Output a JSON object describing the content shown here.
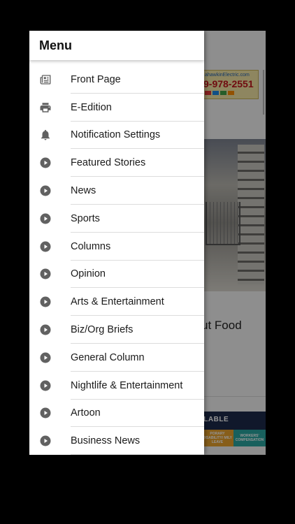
{
  "drawer": {
    "title": "Menu",
    "items": [
      {
        "label": "Front Page",
        "icon": "newspaper-icon"
      },
      {
        "label": "E-Edition",
        "icon": "printer-icon"
      },
      {
        "label": "Notification Settings",
        "icon": "bell-icon"
      },
      {
        "label": "Featured Stories",
        "icon": "play-circle-icon"
      },
      {
        "label": "News",
        "icon": "play-circle-icon"
      },
      {
        "label": "Sports",
        "icon": "play-circle-icon"
      },
      {
        "label": "Columns",
        "icon": "play-circle-icon"
      },
      {
        "label": "Opinion",
        "icon": "play-circle-icon"
      },
      {
        "label": "Arts & Entertainment",
        "icon": "play-circle-icon"
      },
      {
        "label": "Biz/Org Briefs",
        "icon": "play-circle-icon"
      },
      {
        "label": "General Column",
        "icon": "play-circle-icon"
      },
      {
        "label": "Nightlife & Entertainment",
        "icon": "play-circle-icon"
      },
      {
        "label": "Artoon",
        "icon": "play-circle-icon"
      },
      {
        "label": "Business News",
        "icon": "play-circle-icon"
      }
    ]
  },
  "background": {
    "ad_url": "ahawkinElectric.com",
    "ad_phone": "9-978-2551",
    "headline_fragment": "ut Food",
    "banner_text": "ILABLE",
    "banner_tile_1": "PORARY DISABILITY/ MILY LEAVE",
    "banner_tile_2": "WORKERS' COMPENSATION"
  },
  "colors": {
    "icon": "#616161",
    "scrim": "rgba(0,0,0,0.42)",
    "banner": "#1c2a4a"
  }
}
